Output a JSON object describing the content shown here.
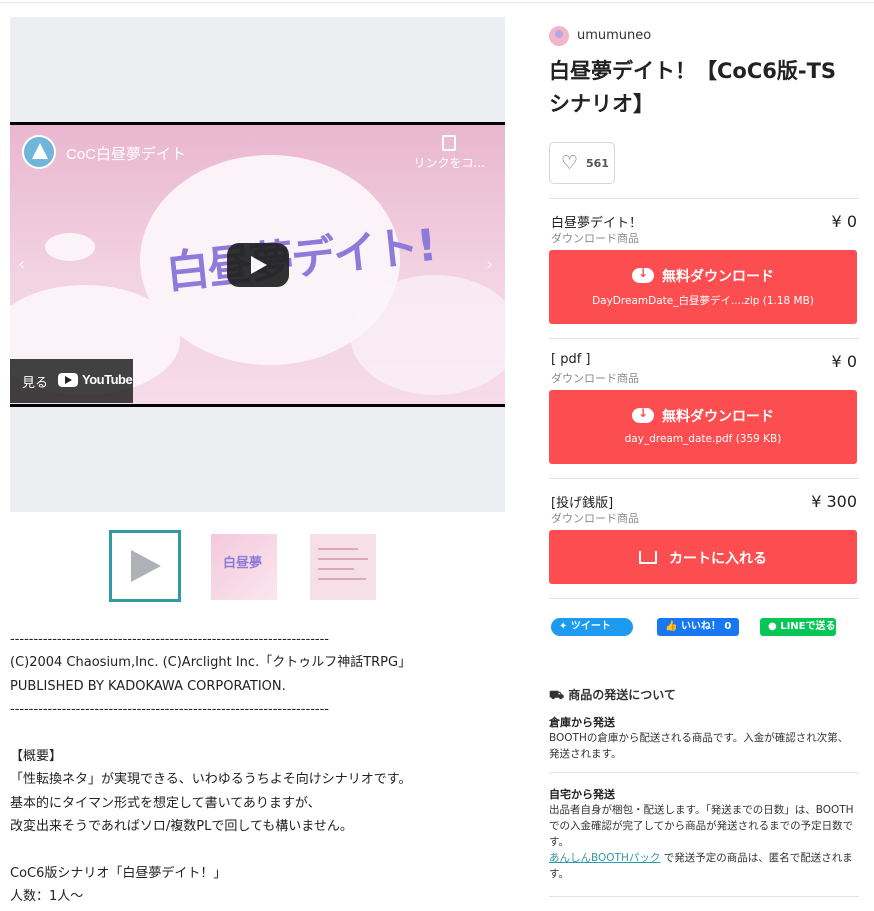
{
  "video": {
    "channel_title": "CoC白昼夢デイト",
    "copy_label": "リンクをコ...",
    "logo_text": "白昼夢デイト!",
    "watch_label": "見る",
    "youtube_label": "YouTube"
  },
  "description": {
    "text": "--------------------------------------------------------------------\n(C)2004 Chaosium,Inc. (C)Arclight Inc.「クトゥルフ神話TRPG」\nPUBLISHED BY KADOKAWA CORPORATION.\n--------------------------------------------------------------------\n\n【概要】\n「性転換ネタ」が実現できる、いわゆるうちよそ向けシナリオです。\n基本的にタイマン形式を想定して書いてありますが、\n改変出来そうであればソロ/複数PLで回しても構いません。\n\nCoC6版シナリオ「白昼夢デイト！」\n人数：1人〜"
  },
  "shop": {
    "name": "umumuneo"
  },
  "product": {
    "title": "白昼夢デイト！【CoC6版-TSシナリオ】",
    "likes": "561"
  },
  "variants": [
    {
      "name": "白昼夢デイト！",
      "price": "¥ 0",
      "type": "ダウンロード商品",
      "button_label": "無料ダウンロード",
      "file": "DayDreamDate_白昼夢デイ....zip (1.18 MB)"
    },
    {
      "name": "[ pdf ]",
      "price": "¥ 0",
      "type": "ダウンロード商品",
      "button_label": "無料ダウンロード",
      "file": "day_dream_date.pdf (359 KB)"
    },
    {
      "name": "[投げ銭版]",
      "price": "¥ 300",
      "type": "ダウンロード商品",
      "button_label": "カートに入れる"
    }
  ],
  "social": {
    "tweet": "ツイート",
    "like": "いいね！ 0",
    "line": "LINEで送る"
  },
  "shipping": {
    "title": "商品の発送について",
    "warehouse_heading": "倉庫から発送",
    "warehouse_text": "BOOTHの倉庫から配送される商品です。入金が確認され次第、発送されます。",
    "home_heading": "自宅から発送",
    "home_text": "出品者自身が梱包・配送します。「発送までの日数」は、BOOTHでの入金確認が完了してから商品が発送されるまでの予定日数です。",
    "home_link": "あんしんBOOTHパック",
    "home_link_suffix": " で発送予定の商品は、匿名で配送されます。"
  }
}
